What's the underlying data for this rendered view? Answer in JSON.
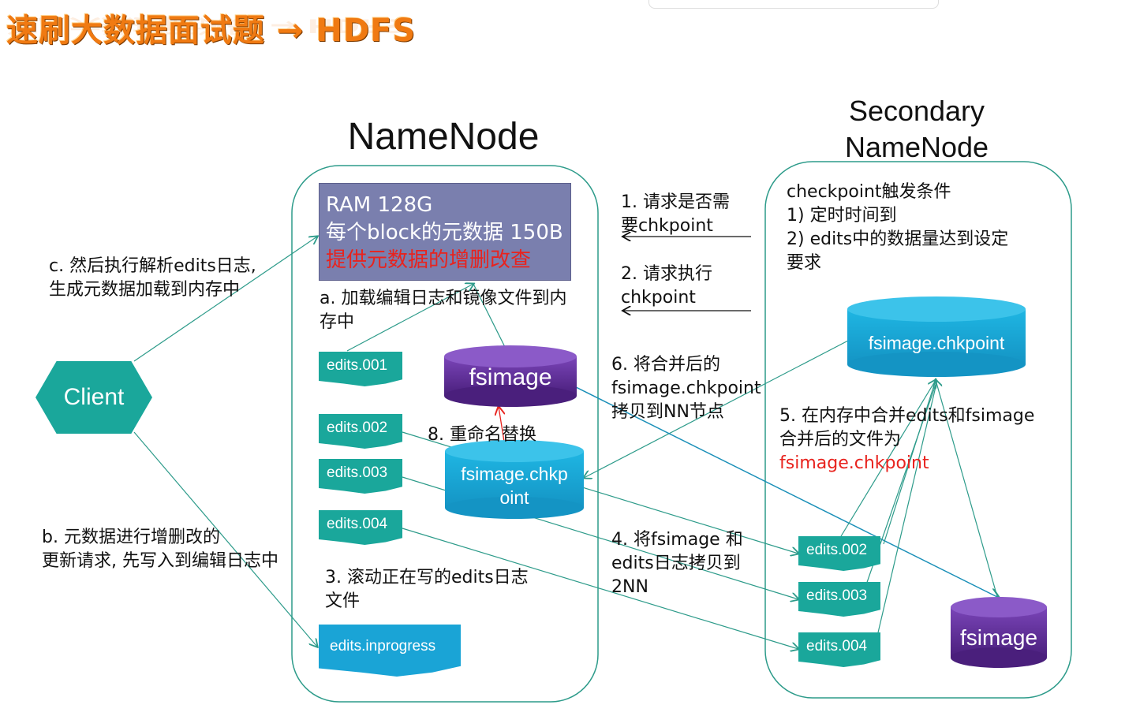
{
  "title": "速刷大数据面试题 → HDFS",
  "namenode": {
    "title": "NameNode",
    "ram": {
      "line1": "RAM 128G",
      "line2": "每个block的元数据 150B",
      "line3": "提供元数据的增删改查"
    },
    "step_a": [
      "a. 加载编辑日志和镜像文件到内",
      "存中"
    ],
    "edits": [
      "edits.001",
      "edits.002",
      "edits.003",
      "edits.004"
    ],
    "fsimage": "fsimage",
    "fsimage_chkpoint": [
      "fsimage.chkp",
      "oint"
    ],
    "step_8": "8. 重命名替换",
    "step_3": [
      "3. 滚动正在写的edits日志",
      "文件"
    ],
    "inprogress": "edits.inprogress"
  },
  "secondary": {
    "title": [
      "Secondary",
      "NameNode"
    ],
    "conditions": [
      "checkpoint触发条件",
      "1) 定时时间到",
      "2) edits中的数据量达到设定",
      "要求"
    ],
    "chkpoint_db": "fsimage.chkpoint",
    "step_5": [
      "5. 在内存中合并edits和fsimage",
      "合并后的文件为"
    ],
    "step_5_file": "fsimage.chkpoint",
    "edits": [
      "edits.002",
      "edits.003",
      "edits.004"
    ],
    "fsimage": "fsimage"
  },
  "client": "Client",
  "step_c": [
    "c. 然后执行解析edits日志,",
    "生成元数据加载到内存中"
  ],
  "step_b": [
    "b. 元数据进行增删改的",
    "更新请求, 先写入到编辑日志中"
  ],
  "step_1": [
    "1. 请求是否需",
    "要chkpoint"
  ],
  "step_2": [
    "2. 请求执行",
    "chkpoint"
  ],
  "step_6": [
    "6. 将合并后的",
    "fsimage.chkpoint",
    "拷贝到NN节点"
  ],
  "step_4": [
    "4. 将fsimage 和",
    "edits日志拷贝到",
    "2NN"
  ],
  "colors": {
    "teal": "#1aa79b",
    "purple": "#5c2d91",
    "ram_bg": "#7a7fae",
    "red": "#e8231e",
    "title_orange": "#f07a12",
    "connector": "#2d9b8a"
  }
}
